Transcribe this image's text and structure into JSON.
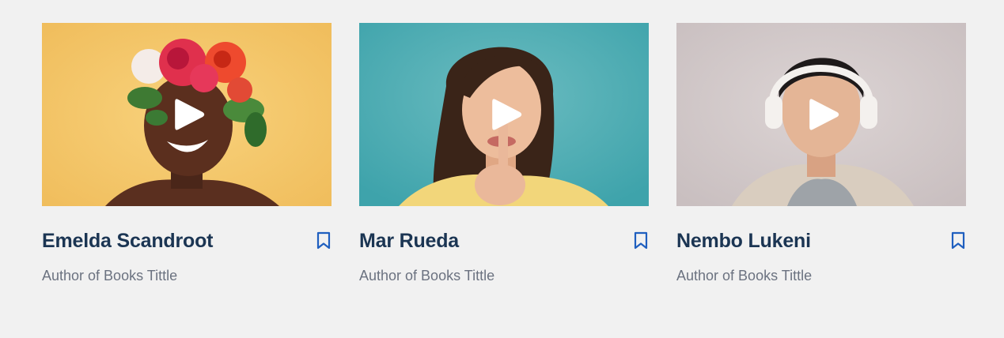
{
  "cards": [
    {
      "name": "Emelda Scandroot",
      "subtitle": "Author of Books Tittle",
      "thumbnail_bg": "#f4c56a",
      "thumbnail": "woman-with-flower-crown"
    },
    {
      "name": "Mar Rueda",
      "subtitle": "Author of Books Tittle",
      "thumbnail_bg": "#4fadb4",
      "thumbnail": "woman-shushing"
    },
    {
      "name": "Nembo Lukeni",
      "subtitle": "Author of Books Tittle",
      "thumbnail_bg": "#d4cbcb",
      "thumbnail": "man-with-headphones"
    }
  ],
  "colors": {
    "page_bg": "#f1f1f1",
    "name_text": "#1b3553",
    "subtitle_text": "#6b7280",
    "bookmark_icon": "#1f5fbf",
    "play_icon": "#ffffff"
  },
  "icons": {
    "play": "play-icon",
    "bookmark": "bookmark-icon"
  }
}
